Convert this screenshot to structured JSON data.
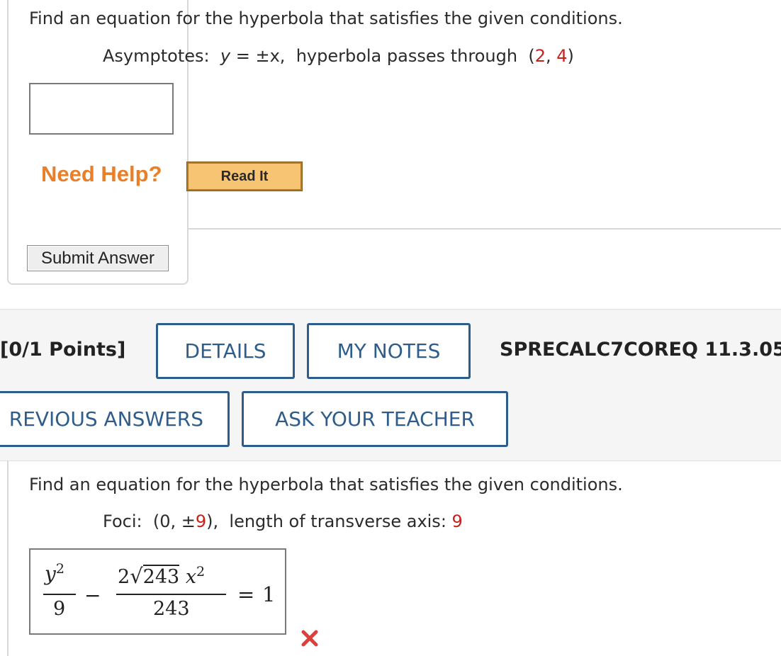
{
  "question1": {
    "prompt": "Find an equation for the hyperbola that satisfies the given conditions.",
    "condition_label": "Asymptotes:",
    "y_var": "y",
    "equals": "=",
    "pm_x": "±x,",
    "condition_rest": "hyperbola passes through",
    "point_open": "(",
    "point_x": "2",
    "point_comma": ",",
    "point_y": "4",
    "point_close": ")",
    "answer_value": "",
    "need_help_label": "Need Help?",
    "read_it_label": "Read It",
    "submit_label": "Submit Answer"
  },
  "question2_header": {
    "points": "[0/1 Points]",
    "details_label": "DETAILS",
    "my_notes_label": "MY NOTES",
    "code": "SPRECALC7COREQ 11.3.05",
    "previous_answers_label": "REVIOUS ANSWERS",
    "ask_teacher_label": "ASK YOUR TEACHER"
  },
  "question2": {
    "prompt": "Find an equation for the hyperbola that satisfies the given conditions.",
    "foci_label": "Foci:",
    "foci_value_prefix": "(0, ±",
    "foci_value_num": "9",
    "foci_value_suffix": "),",
    "transverse_label": "length of transverse axis:",
    "transverse_value": "9",
    "answer": {
      "term1_num_var": "y",
      "term1_num_exp": "2",
      "term1_den": "9",
      "minus": "−",
      "term2_coef": "2",
      "term2_radicand": "243",
      "term2_var": "x",
      "term2_exp": "2",
      "term2_den": "243",
      "equals": "=",
      "rhs": "1"
    },
    "status_icon": "wrong-x-icon",
    "status_color": "#d9413a"
  },
  "colors": {
    "accent_blue": "#2e5d8c",
    "need_help_orange": "#e8802a",
    "value_red": "#c8201b"
  }
}
